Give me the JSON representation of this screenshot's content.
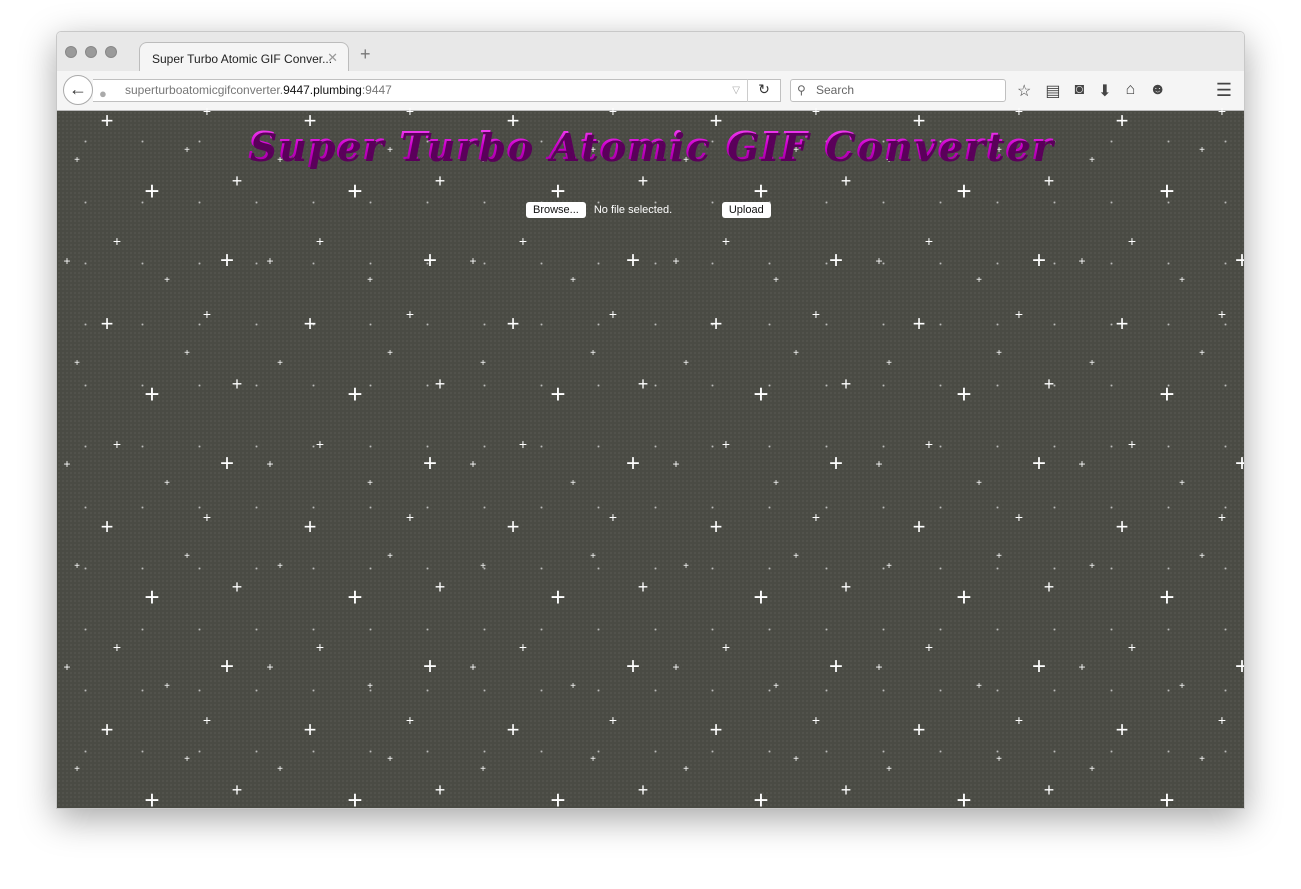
{
  "browser": {
    "tab_title": "Super Turbo Atomic GIF Conver...",
    "url_prefix": "superturboatomicgifconverter.",
    "url_domain": "9447.plumbing",
    "url_port": ":9447",
    "search_placeholder": "Search"
  },
  "page": {
    "title": "Super Turbo Atomic GIF Converter",
    "browse_label": "Browse...",
    "file_status": "No file selected.",
    "upload_label": "Upload",
    "title_color": "#e020e0",
    "background_color": "#4a4b44"
  }
}
